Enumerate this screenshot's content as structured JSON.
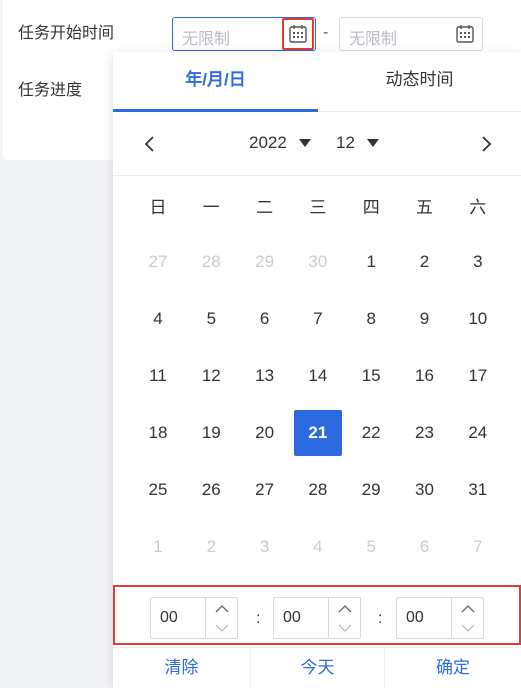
{
  "form": {
    "start_time_label": "任务开始时间",
    "progress_label": "任务进度",
    "start_placeholder": "无限制",
    "end_placeholder": "无限制",
    "range_separator": "-"
  },
  "picker": {
    "tabs": [
      "年/月/日",
      "动态时间"
    ],
    "active_tab": 0,
    "year": "2022",
    "month": "12",
    "weekdays": [
      "日",
      "一",
      "二",
      "三",
      "四",
      "五",
      "六"
    ],
    "weeks": [
      [
        "27",
        "28",
        "29",
        "30",
        "1",
        "2",
        "3"
      ],
      [
        "4",
        "5",
        "6",
        "7",
        "8",
        "9",
        "10"
      ],
      [
        "11",
        "12",
        "13",
        "14",
        "15",
        "16",
        "17"
      ],
      [
        "18",
        "19",
        "20",
        "21",
        "22",
        "23",
        "24"
      ],
      [
        "25",
        "26",
        "27",
        "28",
        "29",
        "30",
        "31"
      ],
      [
        "1",
        "2",
        "3",
        "4",
        "5",
        "6",
        "7"
      ]
    ],
    "selected_day": "21",
    "time": {
      "hour": "00",
      "minute": "00",
      "second": "00",
      "separator": ":"
    },
    "footer": {
      "clear": "清除",
      "today": "今天",
      "confirm": "确定"
    }
  },
  "colors": {
    "accent": "#2d6ae0",
    "highlight": "#e23b3b",
    "muted": "#c9ccd2"
  },
  "icons": {
    "calendar": "calendar-icon",
    "prev": "chevron-left-icon",
    "next": "chevron-right-icon",
    "dropdown": "caret-down-icon",
    "increment": "chevron-up-icon",
    "decrement": "chevron-down-icon"
  }
}
